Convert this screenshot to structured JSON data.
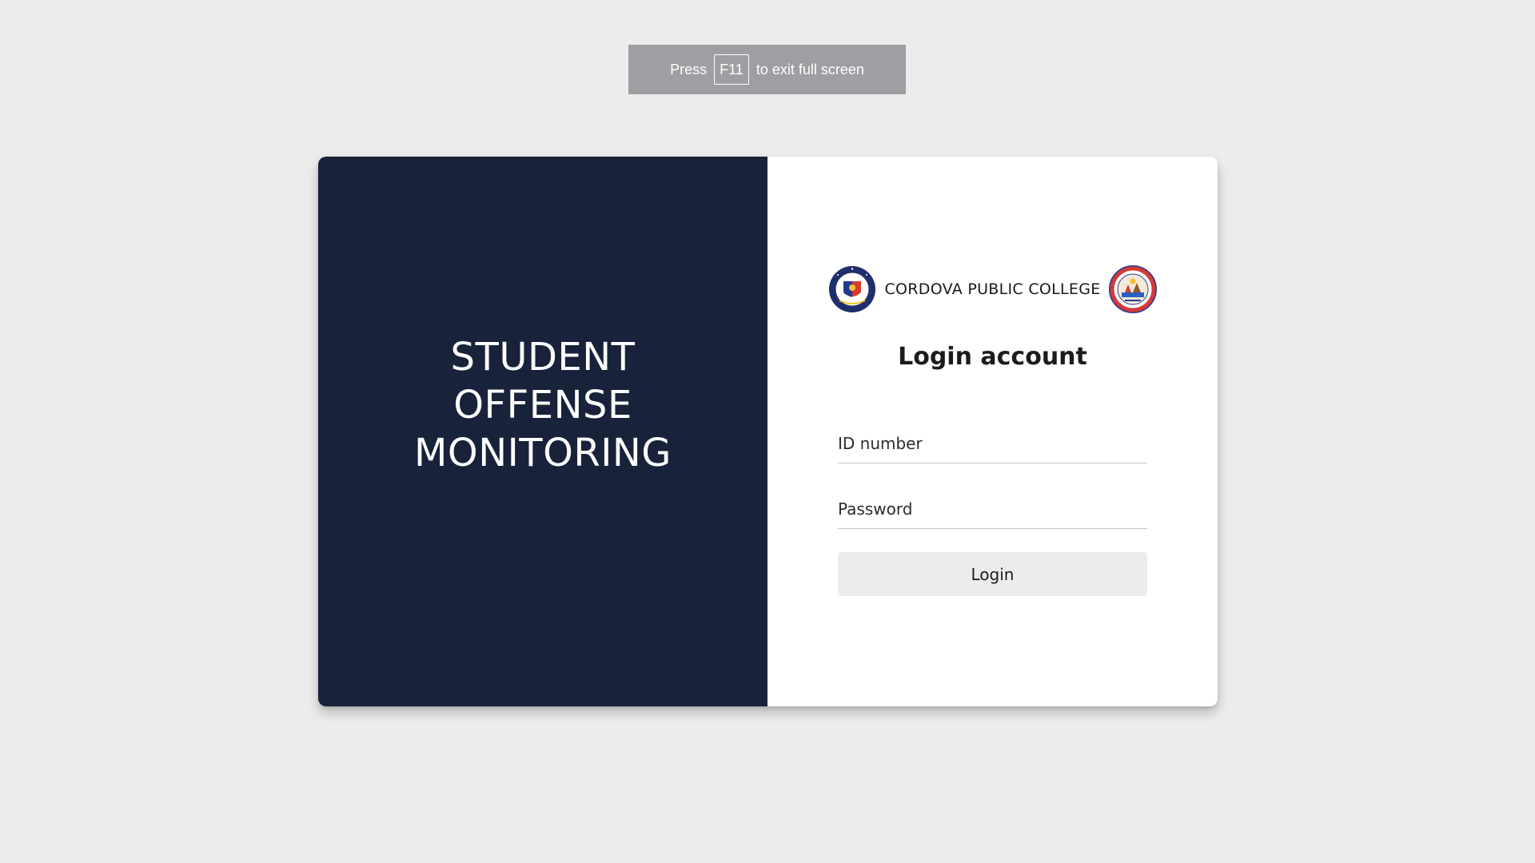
{
  "fullscreen_notice": {
    "prefix": "Press",
    "key": "F11",
    "suffix": "to exit full screen"
  },
  "left_panel": {
    "title_lines": [
      "STUDENT",
      "OFFENSE",
      "MONITORING"
    ],
    "background": "#18223a"
  },
  "header": {
    "college_name": "CORDOVA PUBLIC COLLEGE",
    "left_seal_icon": "college-seal-icon",
    "right_seal_icon": "municipality-seal-icon"
  },
  "login": {
    "heading": "Login account",
    "id_placeholder": "ID number",
    "id_value": "",
    "password_placeholder": "Password",
    "password_value": "",
    "button_label": "Login"
  }
}
